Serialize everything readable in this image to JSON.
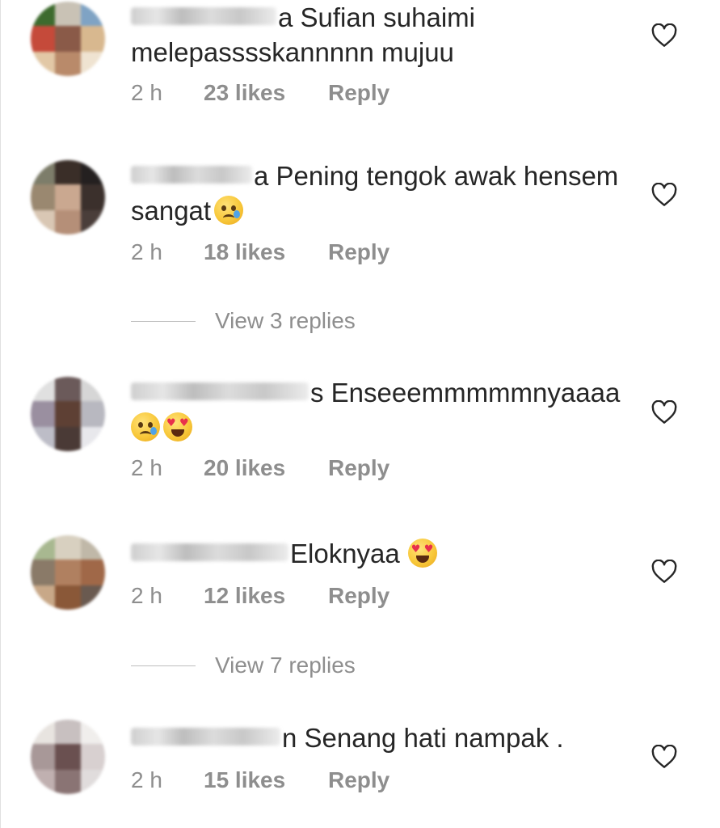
{
  "comments": [
    {
      "line1": "a Sufian suhaimi",
      "line2": "melepasssskannnnn mujuu",
      "time": "2 h",
      "likes": "23 likes",
      "reply": "Reply"
    },
    {
      "line1": "a Pening tengok awak hensem",
      "line2": "sangat",
      "emojis": [
        "crying-face-emoji"
      ],
      "time": "2 h",
      "likes": "18 likes",
      "reply": "Reply"
    },
    {
      "line1": "s Enseeemmmmmnyaaaa",
      "emojis": [
        "crying-face-emoji",
        "heart-eyes-emoji"
      ],
      "time": "2 h",
      "likes": "20 likes",
      "reply": "Reply"
    },
    {
      "line1": "Eloknyaa",
      "emojis": [
        "heart-eyes-emoji"
      ],
      "time": "2 h",
      "likes": "12 likes",
      "reply": "Reply"
    },
    {
      "line1": "n Senang hati nampak .",
      "time": "2 h",
      "likes": "15 likes",
      "reply": "Reply"
    }
  ],
  "view_replies": [
    {
      "label": "View 3 replies"
    },
    {
      "label": "View 7 replies"
    }
  ],
  "icons": {
    "like": "heart-outline-icon"
  },
  "colors": {
    "text": "#262626",
    "meta": "#8e8e8e",
    "divider": "#bdbdbd"
  }
}
